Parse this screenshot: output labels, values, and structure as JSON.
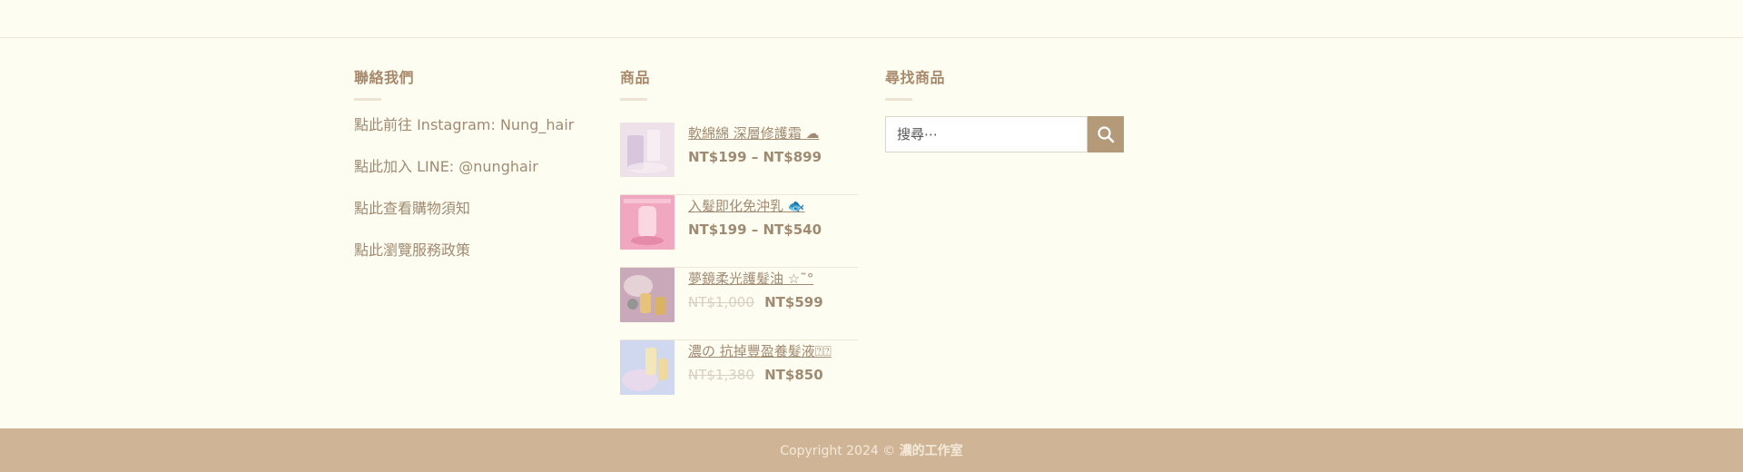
{
  "contact": {
    "title": "聯絡我們",
    "links": [
      {
        "label": "點此前往 Instagram: Nung_hair"
      },
      {
        "label": "點此加入 LINE: @nunghair"
      },
      {
        "label": "點此查看購物須知"
      },
      {
        "label": "點此瀏覽服務政策"
      }
    ]
  },
  "products": {
    "title": "商品",
    "items": [
      {
        "name": "軟綿綿 深層修護霜 ☁",
        "price": "NT$199 – NT$899",
        "old_price": null,
        "thumb_colors": [
          "#efe1ea",
          "#d8c7dc",
          "#f6eef2"
        ]
      },
      {
        "name": "入髮即化免沖乳 🐟",
        "price": "NT$199 – NT$540",
        "old_price": null,
        "thumb_colors": [
          "#f1a7bf",
          "#e58aa8",
          "#fbd7e2"
        ]
      },
      {
        "name": "夢鏡柔光護髮油 ☆˜°",
        "price": "NT$599",
        "old_price": "NT$1,000",
        "thumb_colors": [
          "#c9a9b9",
          "#e5d2d6",
          "#b09498"
        ]
      },
      {
        "name": "濃の 抗掉豐盈養髮液⍰⍰",
        "price": "NT$850",
        "old_price": "NT$1,380",
        "thumb_colors": [
          "#cfd8ee",
          "#e8d9ec",
          "#f3e6b8"
        ]
      }
    ]
  },
  "search": {
    "title": "尋找商品",
    "placeholder": "搜尋⋯"
  },
  "footer": {
    "prefix": "Copyright 2024 © ",
    "brand": "濃的工作室"
  }
}
